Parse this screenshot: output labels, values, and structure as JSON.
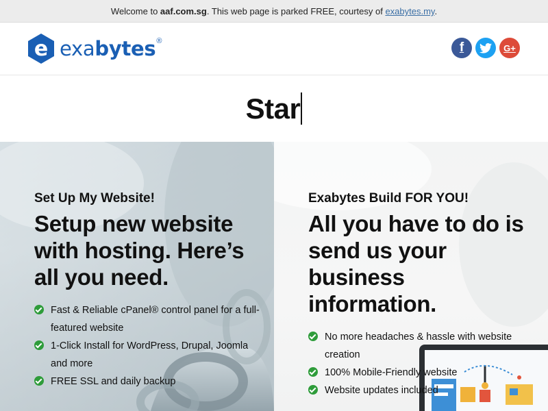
{
  "topbar": {
    "prefix": "Welcome to ",
    "domain": "aaf.com.sg",
    "middle": ". This web page is parked FREE, courtesy of ",
    "link": "exabytes.my",
    "suffix": "."
  },
  "brand": {
    "logo_letter": "e",
    "name_light": "exa",
    "name_bold": "bytes",
    "registered": "®",
    "color": "#1a5fb4"
  },
  "social": [
    {
      "name": "facebook",
      "glyph": "f",
      "color": "#3b5998"
    },
    {
      "name": "twitter",
      "glyph": "t",
      "color": "#1da1f2"
    },
    {
      "name": "google-plus",
      "glyph": "G+",
      "color": "#dd4b39"
    }
  ],
  "typed_text": "Star",
  "left_panel": {
    "kicker": "Set Up My Website!",
    "headline": "Setup new website with hosting. Here’s all you need.",
    "features": [
      "Fast & Reliable cPanel® control panel for a full-featured website",
      "1-Click Install for WordPress, Drupal, Joomla and more",
      "FREE SSL and daily backup"
    ]
  },
  "right_panel": {
    "kicker": "Exabytes Build FOR YOU!",
    "headline": "All you have to do is send us your business information.",
    "features": [
      "No more headaches & hassle with website creation",
      "100% Mobile-Friendly website",
      "Website updates included"
    ]
  },
  "colors": {
    "check_green": "#2e9c3a",
    "link_blue": "#3a6ea5"
  }
}
